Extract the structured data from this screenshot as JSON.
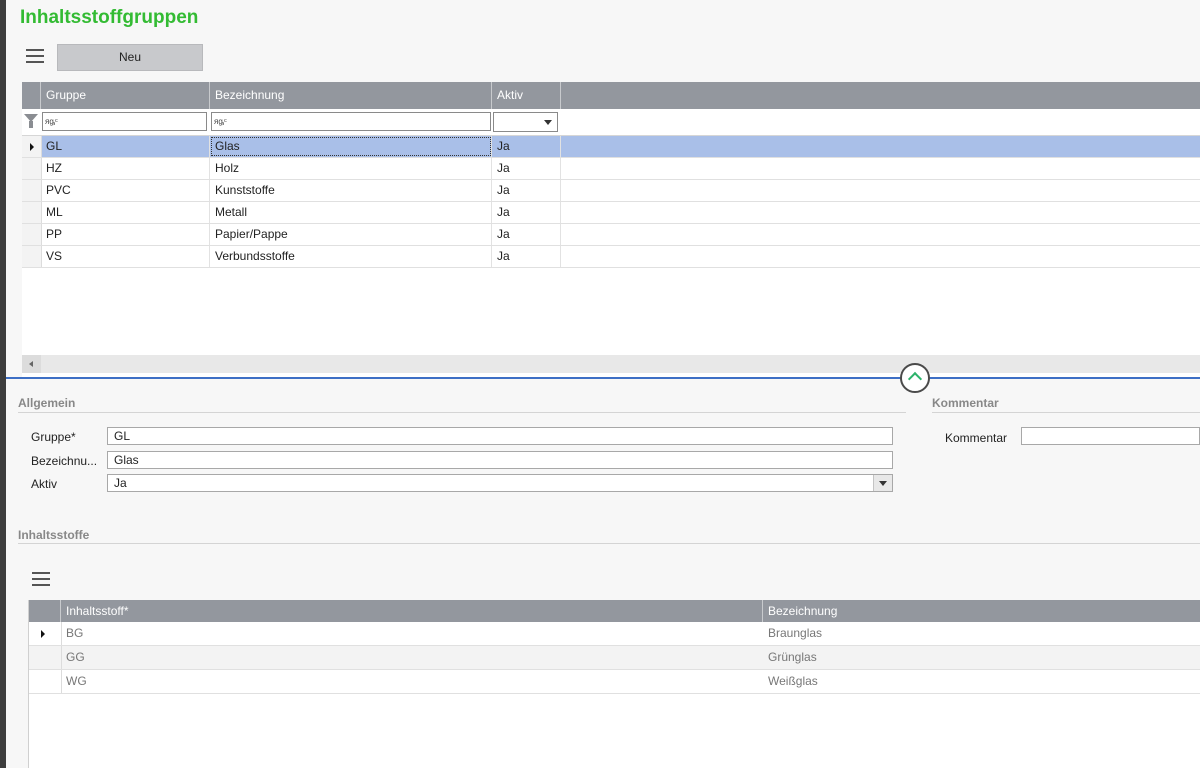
{
  "page": {
    "title": "Inhaltsstoffgruppen"
  },
  "toolbar": {
    "new_label": "Neu"
  },
  "grid": {
    "columns": [
      "Gruppe",
      "Bezeichnung",
      "Aktiv"
    ],
    "filter_placeholder_1": "ᴙᶃᶜ",
    "filter_placeholder_2": "ᴙᶃᶜ",
    "rows": [
      {
        "gruppe": "GL",
        "bezeichnung": "Glas",
        "aktiv": "Ja"
      },
      {
        "gruppe": "HZ",
        "bezeichnung": "Holz",
        "aktiv": "Ja"
      },
      {
        "gruppe": "PVC",
        "bezeichnung": "Kunststoffe",
        "aktiv": "Ja"
      },
      {
        "gruppe": "ML",
        "bezeichnung": "Metall",
        "aktiv": "Ja"
      },
      {
        "gruppe": "PP",
        "bezeichnung": "Papier/Pappe",
        "aktiv": "Ja"
      },
      {
        "gruppe": "VS",
        "bezeichnung": "Verbundsstoffe",
        "aktiv": "Ja"
      }
    ]
  },
  "allgemein": {
    "title": "Allgemein",
    "gruppe_label": "Gruppe*",
    "gruppe_value": "GL",
    "bezeichnung_label": "Bezeichnu...",
    "bezeichnung_value": "Glas",
    "aktiv_label": "Aktiv",
    "aktiv_value": "Ja"
  },
  "kommentar": {
    "title": "Kommentar",
    "label": "Kommentar",
    "value": ""
  },
  "inhaltsstoffe": {
    "title": "Inhaltsstoffe",
    "columns": [
      "Inhaltsstoff*",
      "Bezeichnung"
    ],
    "rows": [
      {
        "inhaltsstoff": "BG",
        "bezeichnung": "Braunglas"
      },
      {
        "inhaltsstoff": "GG",
        "bezeichnung": "Grünglas"
      },
      {
        "inhaltsstoff": "WG",
        "bezeichnung": "Weißglas"
      }
    ]
  }
}
